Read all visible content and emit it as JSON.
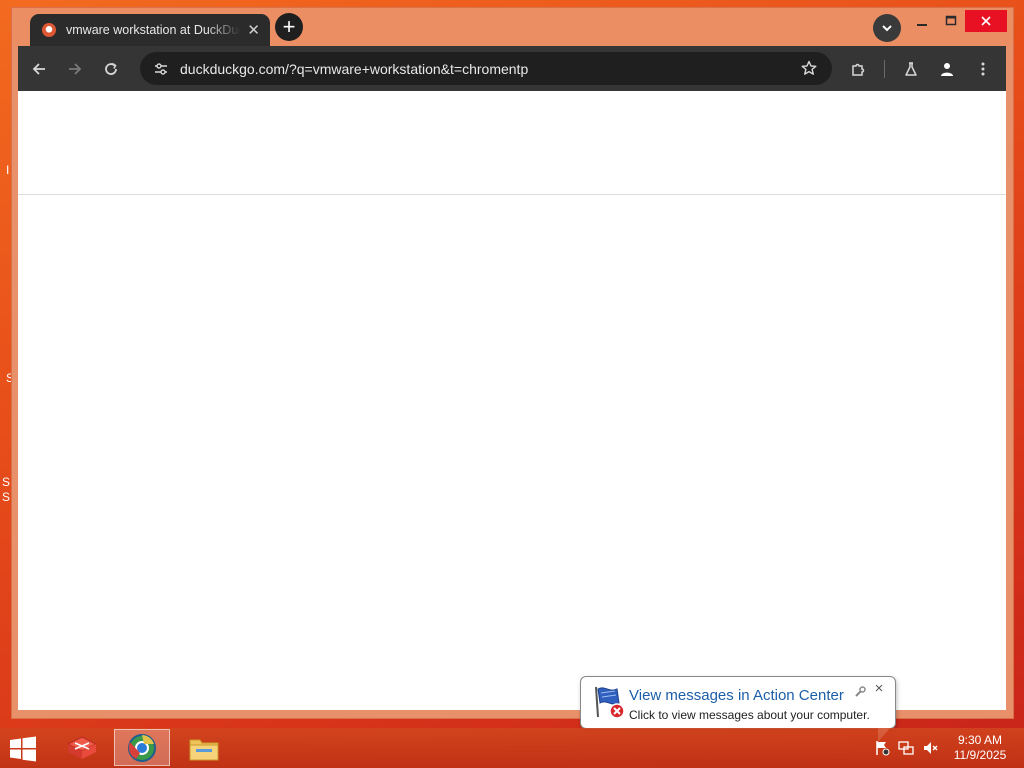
{
  "desktop": {
    "fragments": [
      "I",
      "S",
      "S",
      "S"
    ]
  },
  "browser": {
    "tab": {
      "title": "vmware workstation at DuckDuckGo",
      "favicon": "duckduckgo-icon"
    },
    "toolbar": {
      "url": "duckduckgo.com/?q=vmware+workstation&t=chromentp"
    },
    "icons": {
      "back": "arrow-left-icon",
      "forward": "arrow-right-icon",
      "reload": "reload-icon",
      "site_info": "tune-icon",
      "bookmark": "star-icon",
      "extensions": "puzzle-icon",
      "labs": "flask-icon",
      "profile": "person-icon",
      "menu": "kebab-menu-icon",
      "new_tab": "plus-icon",
      "tab_search": "chevron-down-icon"
    },
    "colors": {
      "frame": "#ec8e64",
      "tab": "#2b2b2b",
      "toolbar": "#353535",
      "omnibox": "#1f1f1f",
      "close": "#e81123"
    }
  },
  "taskbar": {
    "apps": [
      {
        "name": "app-icon",
        "active": false
      },
      {
        "name": "browser-icon",
        "active": true
      },
      {
        "name": "file-explorer-icon",
        "active": false
      }
    ],
    "clock": {
      "time": "9:30 AM",
      "date": "11/9/2025"
    }
  },
  "notification": {
    "title": "View messages in Action Center",
    "body": "Click to view messages about your computer.",
    "icon": "action-center-flag-icon"
  }
}
